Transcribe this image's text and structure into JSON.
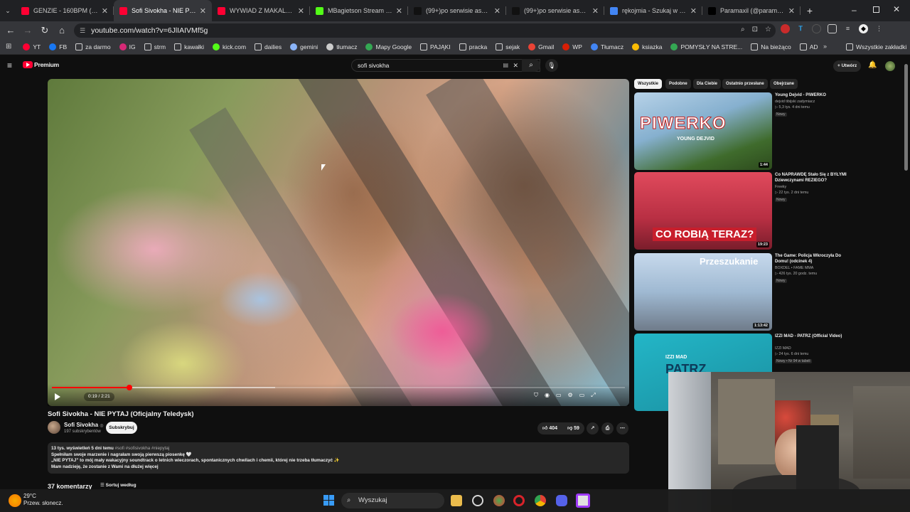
{
  "browser": {
    "tabs": [
      {
        "title": "GENZIE - 160BPM (ft. Wo",
        "favicon_color": "#ff0033",
        "active": false
      },
      {
        "title": "Sofi Sivokha - NIE PYTAJ (",
        "favicon_color": "#ff0033",
        "active": true
      },
      {
        "title": "WYWIAD Z MAKALAJEREM",
        "favicon_color": "#ff0033",
        "active": false
      },
      {
        "title": "MBagietson Stream - Wat",
        "favicon_color": "#53fc18",
        "active": false
      },
      {
        "title": "(99+)po serwisie aso sam",
        "favicon_color": "#111111",
        "active": false
      },
      {
        "title": "(99+)po serwisie aso sam",
        "favicon_color": "#111111",
        "active": false
      },
      {
        "title": "rękojmia - Szukaj w Goog",
        "favicon_color": "#4285f4",
        "active": false
      },
      {
        "title": "Paramaxil (@paramaxil_)",
        "favicon_color": "#000000",
        "active": false
      }
    ],
    "url": "youtube.com/watch?v=6JlIAIVMf5g",
    "bookmarks": [
      {
        "label": "YT",
        "icon": "youtube-icon",
        "color": "#ff0033"
      },
      {
        "label": "FB",
        "icon": "facebook-icon",
        "color": "#1877f2"
      },
      {
        "label": "za darmo",
        "icon": "folder-icon",
        "color": ""
      },
      {
        "label": "IG",
        "icon": "instagram-icon",
        "color": "#d62976"
      },
      {
        "label": "strm",
        "icon": "folder-icon",
        "color": ""
      },
      {
        "label": "kawałki",
        "icon": "folder-icon",
        "color": ""
      },
      {
        "label": "kick.com",
        "icon": "kick-icon",
        "color": "#53fc18"
      },
      {
        "label": "dailies",
        "icon": "folder-icon",
        "color": ""
      },
      {
        "label": "gemini",
        "icon": "gemini-icon",
        "color": "#8ab4f8"
      },
      {
        "label": "tłumacz",
        "icon": "translate-icon",
        "color": "#cccccc"
      },
      {
        "label": "Mapy Google",
        "icon": "maps-icon",
        "color": "#34a853"
      },
      {
        "label": "PAJĄKI",
        "icon": "folder-icon",
        "color": ""
      },
      {
        "label": "pracka",
        "icon": "folder-icon",
        "color": ""
      },
      {
        "label": "sejak",
        "icon": "folder-icon",
        "color": ""
      },
      {
        "label": "Gmail",
        "icon": "gmail-icon",
        "color": "#ea4335"
      },
      {
        "label": "WP",
        "icon": "wp-icon",
        "color": "#d81e05"
      },
      {
        "label": "Tłumacz",
        "icon": "translate-icon",
        "color": "#4285f4"
      },
      {
        "label": "ksiazka",
        "icon": "apps-icon",
        "color": "#fbbc04"
      },
      {
        "label": "POMYSŁY NA STRE...",
        "icon": "apps-icon",
        "color": "#34a853"
      },
      {
        "label": "Na bieżąco",
        "icon": "folder-icon",
        "color": ""
      },
      {
        "label": "AD",
        "icon": "folder-icon",
        "color": ""
      }
    ],
    "all_bookmarks_label": "Wszystkie zakładki"
  },
  "youtube": {
    "logo_label": "Premium",
    "search_value": "sofi sivokha",
    "create_label": "Utwórz",
    "player": {
      "time": "0:19 / 2:21",
      "progress_fraction": 0.135,
      "buffer_fraction": 0.39
    },
    "video_title": "Sofi Sivokha - NIE PYTAJ (Oficjalny Teledysk)",
    "channel_name": "Sofi Sivokha",
    "subscribers": "197 subskrybentów",
    "subscribe_label": "Subskrybuj",
    "likes": "404",
    "dislikes": "59",
    "description": {
      "stats": "13 tys. wyświetleń  5 dni temu",
      "tags": "#sofi #sofisivokha #niepytaj",
      "line1": "Spełniłam swoje marzenie i nagrałam swoją pierwszą piosenkę 🤍",
      "line2": "„NIE PYTAJ” to mój mały wakacyjny soundtrack o letnich wieczorach, spontanicznych chwilach i chemii, której nie trzeba tłumaczyć ✨",
      "line3": "Mam nadzieję, że zostanie z Wami na dłużej",
      "more": "więcej"
    },
    "comments_count": "37 komentarzy",
    "sort_label": "Sortuj według",
    "chips": [
      "Wszystkie",
      "Podobne",
      "Dla Ciebie",
      "Ostatnio przesłane",
      "Obejrzane"
    ],
    "recommendations": [
      {
        "title": "Young Dejvid - PIWERKO",
        "channel": "dejvid tibijski zadymiacz",
        "meta": "5,3 tys.   4 dni temu",
        "badge": "Nowy",
        "duration": "1:44",
        "thumb_text": "PIWERKO",
        "thumb_sub": "YOUNG DEJVID"
      },
      {
        "title": "Co NAPRAWDĘ Stało Się z BYŁYMI Dziewczynami REZIEGO?",
        "channel": "Freeky",
        "meta": "22 tys.   2 dni temu",
        "badge": "Nowy",
        "duration": "19:23",
        "thumb_text": "CO ROBIĄ TERAZ?",
        "thumb_sub": ""
      },
      {
        "title": "The Game: Policja Wkroczyła Do Domu! (odcinek 4)",
        "channel": "BOXDEL  • FAME MMA",
        "meta": "426 tys.   20 godz. temu",
        "badge": "Nowy",
        "duration": "1:13:42",
        "thumb_text": "Przeszukanie",
        "thumb_sub": ""
      },
      {
        "title": "IZZI MAD - PATRZ (Official Video)",
        "channel": "IZZI MAD",
        "meta": "24 tys.   6 dni temu",
        "badge": "Nowy  • Nr 94 w tabeli",
        "duration": "",
        "thumb_text": "PATRZ",
        "thumb_sub": "IZZI MAD"
      }
    ]
  },
  "taskbar": {
    "temperature": "29°C",
    "weather": "Przew. słonecz.",
    "search_placeholder": "Wyszukaj"
  }
}
